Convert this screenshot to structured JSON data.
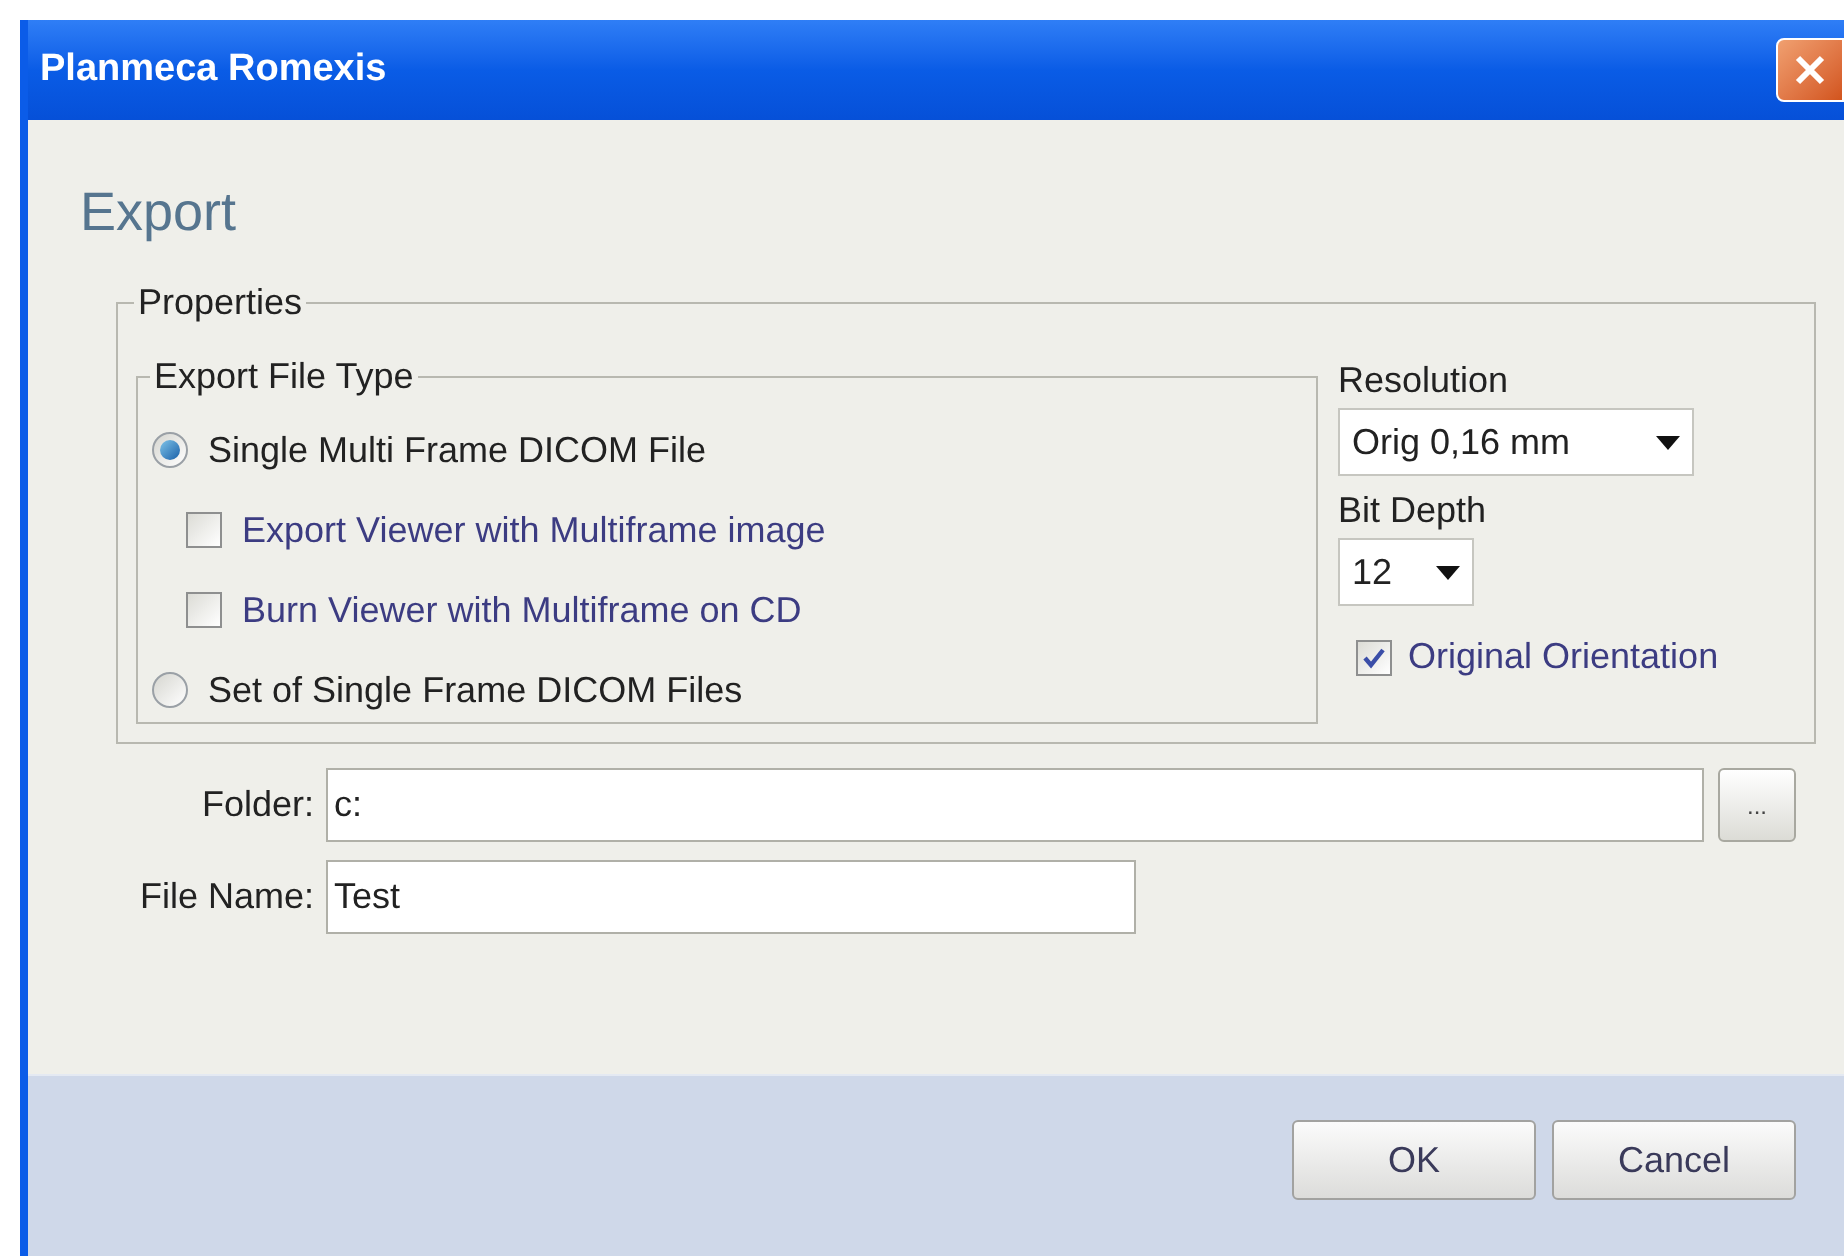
{
  "window": {
    "title": "Planmeca Romexis"
  },
  "heading": "Export",
  "properties": {
    "title": "Properties",
    "file_type": {
      "title": "Export File Type",
      "options": [
        {
          "kind": "radio",
          "label": "Single Multi Frame DICOM File",
          "selected": true
        },
        {
          "kind": "checkbox",
          "label": "Export Viewer with Multiframe image",
          "checked": false
        },
        {
          "kind": "checkbox",
          "label": "Burn Viewer with Multiframe on CD",
          "checked": false
        },
        {
          "kind": "radio",
          "label": "Set of Single Frame DICOM Files",
          "selected": false
        }
      ]
    },
    "resolution": {
      "label": "Resolution",
      "value": "Orig 0,16 mm"
    },
    "bit_depth": {
      "label": "Bit Depth",
      "value": "12"
    },
    "original_orientation": {
      "label": "Original Orientation",
      "checked": true
    }
  },
  "folder": {
    "label": "Folder:",
    "value": "c:",
    "browse": "..."
  },
  "file_name": {
    "label": "File Name:",
    "value": "Test"
  },
  "buttons": [
    {
      "label": "OK"
    },
    {
      "label": "Cancel"
    }
  ]
}
